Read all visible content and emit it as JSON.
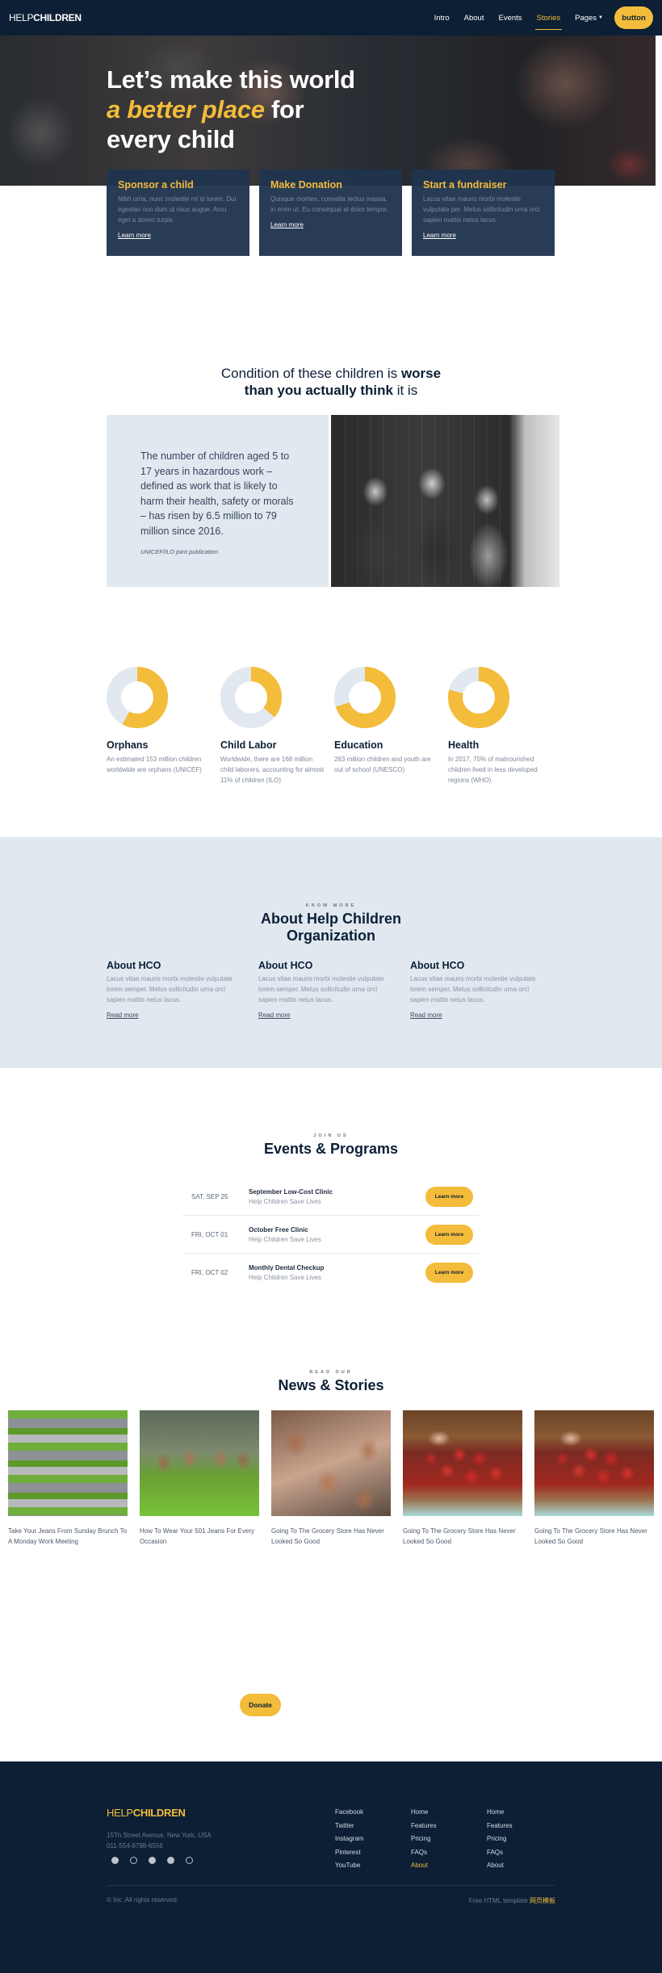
{
  "nav": {
    "logo_light": "HELP",
    "logo_bold": "CHILDREN",
    "links": [
      {
        "label": "Intro",
        "active": false
      },
      {
        "label": "About",
        "active": false
      },
      {
        "label": "Events",
        "active": false
      },
      {
        "label": "Stories",
        "active": true
      },
      {
        "label": "Pages",
        "active": false,
        "dropdown": true
      }
    ],
    "button_label": "button"
  },
  "hero": {
    "line1": "Let’s make this world",
    "accent": "a better place",
    "line2_rest": " for",
    "line3": "every child"
  },
  "cards": [
    {
      "title": "Sponsor a child",
      "text": "Nibh urna, nunc molestie mi id lorem. Dui egestas non dum ut risus augue. Arcu eget a donec turpis.",
      "link": "Learn more"
    },
    {
      "title": "Make Donation",
      "text": "Quisque montes, convallis lectus massa, in enim ut. Eu consequat at dolor tempor.",
      "link": "Learn more"
    },
    {
      "title": "Start a fundraiser",
      "text": "Lacus vitae mauris morbi molestie vulputate per. Metus sollicitudin urna orci sapien mattis netus lacus.",
      "link": "Learn more"
    }
  ],
  "condition": {
    "title_a": "Condition of these children is ",
    "title_bold1": "worse",
    "title_bold2": "than you actually think",
    "title_b": " it is",
    "quote": "The number of children aged 5 to 17 years in hazardous work – defined as work that is likely to harm their health, safety or morals – has risen by 6.5 million to 79 million since 2016.",
    "source": "UNICEF/ILO joint publication"
  },
  "stats": [
    {
      "title": "Orphans",
      "text": "An estimated 153 million children worldwide are orphans (UNICEF)",
      "fill_percent": 58
    },
    {
      "title": "Child Labor",
      "text": "Worldwide, there are 168 million child laborers, accounting for almost 11% of children (ILO)",
      "fill_percent": 36
    },
    {
      "title": "Education",
      "text": "263 million children and youth are out of school (UNESCO)",
      "fill_percent": 70
    },
    {
      "title": "Health",
      "text": "In 2017, 75% of malnourished children lived in less developed regions (WHO)",
      "fill_percent": 79
    }
  ],
  "colors": {
    "accent": "#f3bc3a",
    "navy": "#0c1f35",
    "donut_track": "#e1e8f0"
  },
  "about": {
    "eyebrow": "KNOW MORE",
    "title_line1": "About Help Children",
    "title_line2": "Organization",
    "columns": [
      {
        "title": "About HCO",
        "text": "Lacus vitae mauris morbi molestie vulputate lorem semper. Metus sollicitudin urna orci sapien mattis netus lacus.",
        "link": "Read more"
      },
      {
        "title": "About HCO",
        "text": "Lacus vitae mauris morbi molestie vulputate lorem semper. Metus sollicitudin urna orci sapien mattis netus lacus.",
        "link": "Read more"
      },
      {
        "title": "About HCO",
        "text": "Lacus vitae mauris morbi molestie vulputate lorem semper. Metus sollicitudin urna orci sapien mattis netus lacus.",
        "link": "Read more"
      }
    ]
  },
  "events": {
    "eyebrow": "JOIN US",
    "title": "Events & Programs",
    "items": [
      {
        "date": "SAT, SEP 25",
        "name": "September Low-Cost Clinic",
        "sub": "Help Children Save Lives",
        "button": "Learn more"
      },
      {
        "date": "FRI, OCT 01",
        "name": "October Free Clinic",
        "sub": "Help Children Save Lives",
        "button": "Learn more"
      },
      {
        "date": "FRI, OCT 02",
        "name": "Monthly Dental Checkup",
        "sub": "Help Children Save Lives",
        "button": "Learn more"
      }
    ]
  },
  "news": {
    "eyebrow": "READ OUR",
    "title": "News & Stories",
    "items": [
      {
        "title": "Take Your Jeans From Sunday Brunch To A Monday Work Meeting",
        "image": "garden-building"
      },
      {
        "title": "How To Wear Your 501 Jeans For Every Occasion",
        "image": "kids-in-field"
      },
      {
        "title": "Going To The Grocery Store Has Never Looked So Good",
        "image": "smiling-kids"
      },
      {
        "title": "Going To The Grocery Store Has Never Looked So Good",
        "image": "apples-crate"
      },
      {
        "title": "Going To The Grocery Store Has Never Looked So Good",
        "image": "apples-crate"
      }
    ]
  },
  "donate": {
    "label": "Donate"
  },
  "footer": {
    "logo_light": "HELP",
    "logo_bold": "CHILDREN",
    "address": "15Th Street Avenue, New York, USA",
    "phone": "011-554-8798-6556",
    "social_icons": [
      "facebook-icon",
      "instagram-icon",
      "skype-icon",
      "pinterest-icon",
      "whatsapp-icon"
    ],
    "col1": [
      {
        "label": "Facebook"
      },
      {
        "label": "Twitter"
      },
      {
        "label": "Instagram"
      },
      {
        "label": "Pinterest"
      },
      {
        "label": "YouTube"
      }
    ],
    "col2": [
      {
        "label": "Home"
      },
      {
        "label": "Features"
      },
      {
        "label": "Pricing"
      },
      {
        "label": "FAQs"
      },
      {
        "label": "About",
        "highlight": true
      }
    ],
    "col3": [
      {
        "label": "Home"
      },
      {
        "label": "Features"
      },
      {
        "label": "Pricing"
      },
      {
        "label": "FAQs"
      },
      {
        "label": "About"
      }
    ],
    "copyright": "© Inc. All rights reserved.",
    "credit_text": "Free HTML template ",
    "credit_link": "网页模板"
  }
}
